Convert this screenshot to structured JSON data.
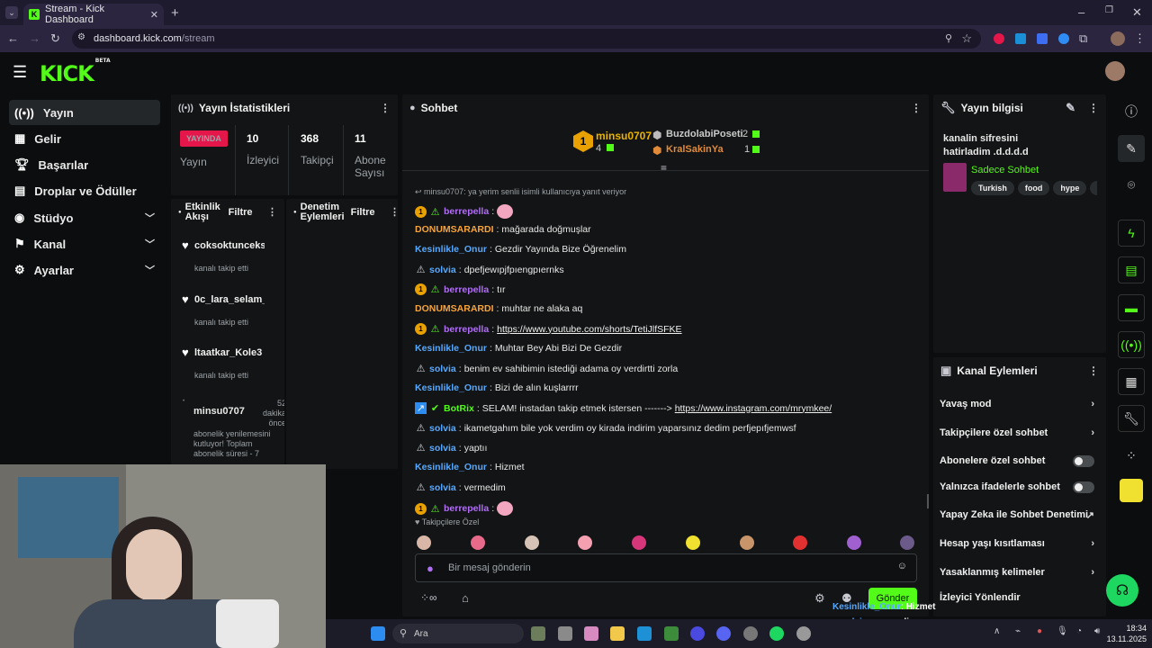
{
  "browser": {
    "tab_title": "Stream - Kick Dashboard",
    "url_host": "dashboard.kick.com",
    "url_path": "/stream"
  },
  "brand": {
    "logo": "KICK",
    "beta": "BETA",
    "accent": "#53fc18"
  },
  "sidebar": {
    "items": [
      {
        "label": "Yayın",
        "active": true,
        "icon": "stream-icon"
      },
      {
        "label": "Gelir",
        "icon": "revenue-icon"
      },
      {
        "label": "Başarılar",
        "icon": "trophy-icon"
      },
      {
        "label": "Droplar ve Ödüller",
        "icon": "gift-icon"
      },
      {
        "label": "Stüdyo",
        "icon": "studio-icon",
        "chevron": true
      },
      {
        "label": "Kanal",
        "icon": "channel-icon",
        "chevron": true
      },
      {
        "label": "Ayarlar",
        "icon": "gear-icon",
        "chevron": true
      }
    ]
  },
  "stats": {
    "title": "Yayın İstatistikleri",
    "live_badge": "YAYINDA",
    "live_label": "Yayın",
    "viewers_value": "10",
    "viewers_label": "İzleyici",
    "followers_value": "368",
    "followers_label": "Takipçi",
    "subs_value": "11",
    "subs_label": "Abone Sayısı"
  },
  "activity": {
    "title": "Etkinlik Akışı",
    "filter": "Filtre",
    "items": [
      {
        "name": "coksoktunceksi",
        "sub": "kanalı takip etti"
      },
      {
        "name": "0c_lara_selam_v",
        "sub": "kanalı takip etti"
      },
      {
        "name": "ltaatkar_Kole3",
        "sub": "kanalı takip etti"
      }
    ],
    "last": {
      "name": "minsu0707",
      "time": "52 dakika önce",
      "text": "abonelik yenilemesini kutluyor! Toplam abonelik süresi - 7"
    }
  },
  "moderation": {
    "title": "Denetim Eylemleri",
    "filter": "Filtre"
  },
  "chat": {
    "title": "Sohbet",
    "top1_name": "minsu0707",
    "top1_count": "4",
    "top2_name": "BuzdolabiPoseti",
    "top2_count": "2",
    "top3_name": "KralSakinYa",
    "top3_count": "1",
    "reply_note": "minsu0707: ya yerim senlii isimli kullanıcıya yanıt veriyor",
    "messages": [
      {
        "user": "berrepella",
        "color": "purple",
        "badges": [
          "sub",
          "mod"
        ],
        "text": "",
        "emote": true
      },
      {
        "user": "DONUMSARARDI",
        "color": "orange",
        "text": "mağarada doğmuşlar"
      },
      {
        "user": "Kesinlikle_Onur",
        "color": "blue",
        "text": "Gezdir Yayında Bize Öğrenelim"
      },
      {
        "user": "solvia",
        "color": "blue",
        "badges": [
          "vip"
        ],
        "text": "dpefjewıpjfpıengpıernks"
      },
      {
        "user": "berrepella",
        "color": "purple",
        "badges": [
          "sub",
          "mod"
        ],
        "text": "tır"
      },
      {
        "user": "DONUMSARARDI",
        "color": "orange",
        "text": "muhtar ne alaka aq"
      },
      {
        "user": "berrepella",
        "color": "purple",
        "badges": [
          "sub",
          "mod"
        ],
        "text": "https://www.youtube.com/shorts/TetiJlfSFKE",
        "link": true
      },
      {
        "user": "Kesinlikle_Onur",
        "color": "blue",
        "text": "Muhtar Bey Abi Bizi De Gezdir"
      },
      {
        "user": "solvia",
        "color": "blue",
        "badges": [
          "vip"
        ],
        "text": "benim ev sahibimin istediği adama oy verdirtti zorla"
      },
      {
        "user": "Kesinlikle_Onur",
        "color": "blue",
        "text": "Bizi de alın kuşlarrrr"
      },
      {
        "user": "BotRix",
        "color": "green",
        "badges": [
          "bot",
          "verified"
        ],
        "text": "SELAM! instadan takip etmek istersen -------> ",
        "linktext": "https://www.instagram.com/mrymkee/"
      },
      {
        "user": "solvia",
        "color": "blue",
        "badges": [
          "vip"
        ],
        "text": "ikametgahım bile yok verdim oy kirada indirim yaparsınız dedim perfjepıfjemwsf"
      },
      {
        "user": "solvia",
        "color": "blue",
        "badges": [
          "vip"
        ],
        "text": "yaptıı"
      },
      {
        "user": "Kesinlikle_Onur",
        "color": "blue",
        "text": "Hizmet"
      },
      {
        "user": "solvia",
        "color": "blue",
        "badges": [
          "vip"
        ],
        "text": "vermedim"
      },
      {
        "user": "berrepella",
        "color": "purple",
        "badges": [
          "sub",
          "mod"
        ],
        "text": "",
        "emote": true
      }
    ],
    "followers_only": "Takipçilere Özel",
    "placeholder": "Bir mesaj gönderin",
    "send": "Gönder"
  },
  "info": {
    "title": "Yayın bilgisi",
    "stream_title": "kanalin sifresini hatirladim .d.d.d.d",
    "category": "Sadece Sohbet",
    "tags": [
      "Turkish",
      "food",
      "hype",
      "tu"
    ]
  },
  "actions": {
    "title": "Kanal Eylemleri",
    "items": [
      {
        "label": "Yavaş mod",
        "type": "chevron"
      },
      {
        "label": "Takipçilere özel sohbet",
        "type": "chevron"
      },
      {
        "label": "Abonelere özel sohbet",
        "type": "toggle",
        "on": false
      },
      {
        "label": "Yalnızca ifadelerle sohbet",
        "type": "toggle",
        "on": false
      },
      {
        "label": "Yapay Zeka ile Sohbet Denetimi",
        "type": "external"
      },
      {
        "label": "Hesap yaşı kısıtlaması",
        "type": "chevron"
      },
      {
        "label": "Yasaklanmış kelimeler",
        "type": "chevron"
      },
      {
        "label": "İzleyici Yönlendir",
        "type": "none"
      }
    ]
  },
  "overlay": {
    "l1": "Kesinlikle_Onur",
    "l1t": "Hizmet",
    "l2": "solvia",
    "l2t": "vermedim",
    "l3": "berrepella"
  },
  "taskbar": {
    "search": "Ara",
    "time": "18:34",
    "date": "13.11.2025"
  }
}
